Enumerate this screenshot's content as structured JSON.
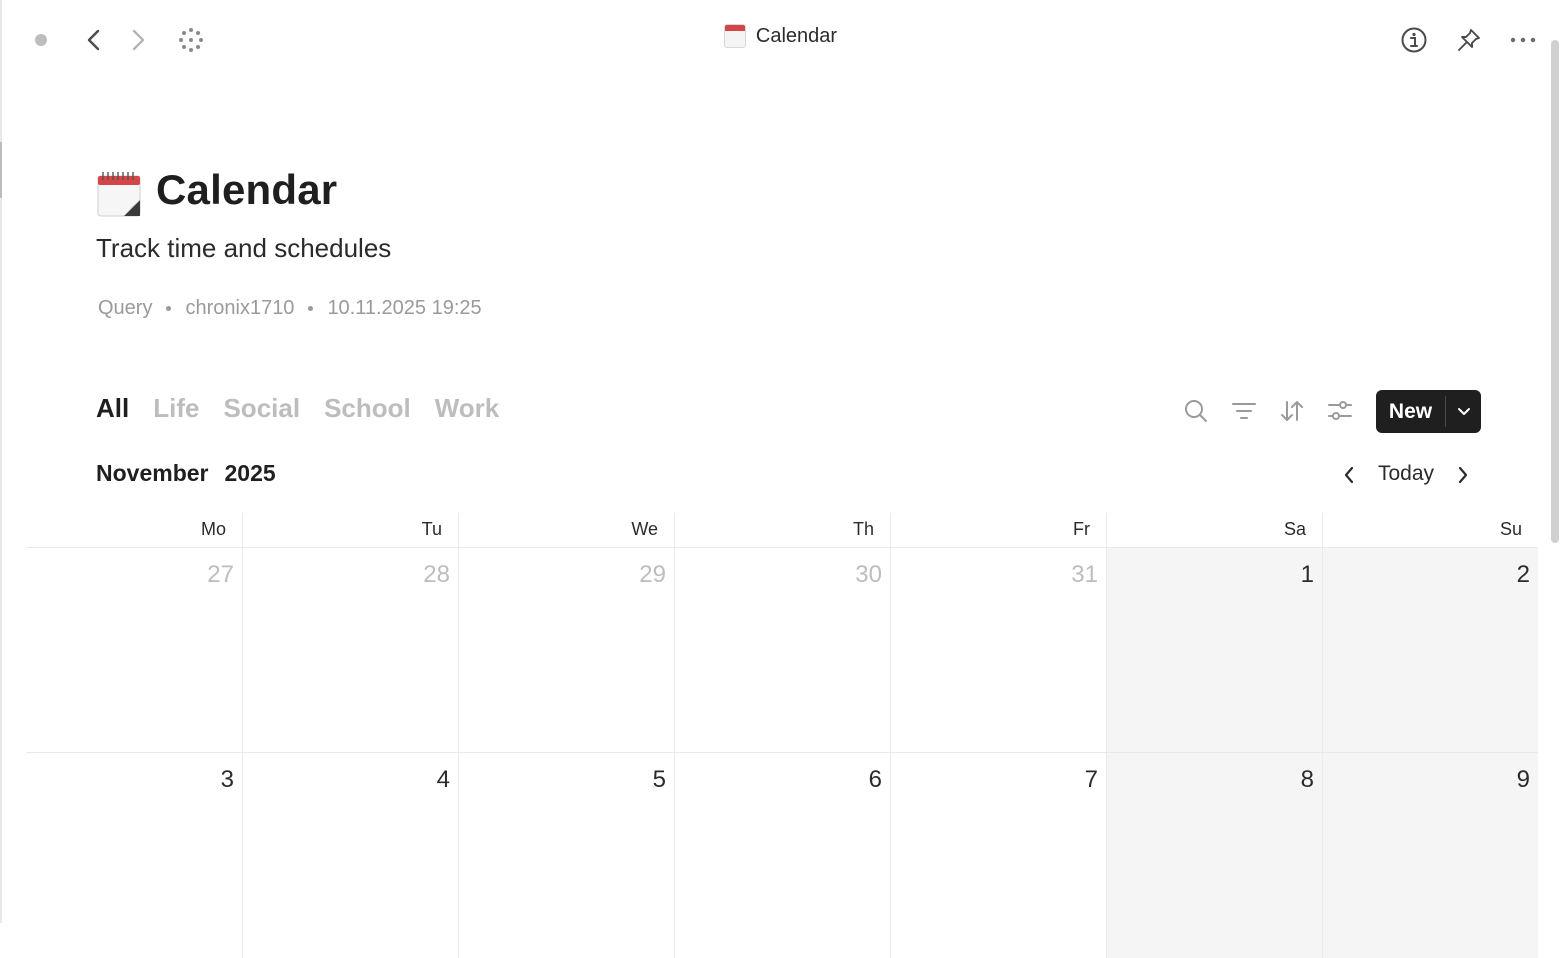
{
  "topbar": {
    "title": "Calendar",
    "icons": [
      "dot-icon",
      "back-icon",
      "forward-icon",
      "grid-dots-icon",
      "info-icon",
      "pin-icon",
      "more-icon"
    ]
  },
  "page": {
    "icon": "calendar-emoji-icon",
    "title": "Calendar",
    "subtitle": "Track time and schedules",
    "meta": {
      "type": "Query",
      "author": "chronix1710",
      "datetime": "10.11.2025 19:25"
    }
  },
  "tabs": [
    {
      "label": "All",
      "active": true
    },
    {
      "label": "Life",
      "active": false
    },
    {
      "label": "Social",
      "active": false
    },
    {
      "label": "School",
      "active": false
    },
    {
      "label": "Work",
      "active": false
    }
  ],
  "toolbar": {
    "icons": [
      "search-icon",
      "filter-icon",
      "sort-icon",
      "settings-sliders-icon"
    ],
    "new_label": "New"
  },
  "calendar": {
    "month": "November",
    "year": "2025",
    "today_label": "Today",
    "weekdays": [
      "Mo",
      "Tu",
      "We",
      "Th",
      "Fr",
      "Sa",
      "Su"
    ],
    "weeks": [
      [
        {
          "day": "27",
          "outside": true
        },
        {
          "day": "28",
          "outside": true
        },
        {
          "day": "29",
          "outside": true
        },
        {
          "day": "30",
          "outside": true
        },
        {
          "day": "31",
          "outside": true
        },
        {
          "day": "1",
          "outside": false
        },
        {
          "day": "2",
          "outside": false
        }
      ],
      [
        {
          "day": "3",
          "outside": false
        },
        {
          "day": "4",
          "outside": false
        },
        {
          "day": "5",
          "outside": false
        },
        {
          "day": "6",
          "outside": false
        },
        {
          "day": "7",
          "outside": false
        },
        {
          "day": "8",
          "outside": false
        },
        {
          "day": "9",
          "outside": false
        }
      ]
    ]
  },
  "colors": {
    "accent": "#1f1f1f",
    "muted": "#bdbdbd",
    "weekend_bg": "#f5f5f5",
    "calendar_red": "#d64545"
  }
}
